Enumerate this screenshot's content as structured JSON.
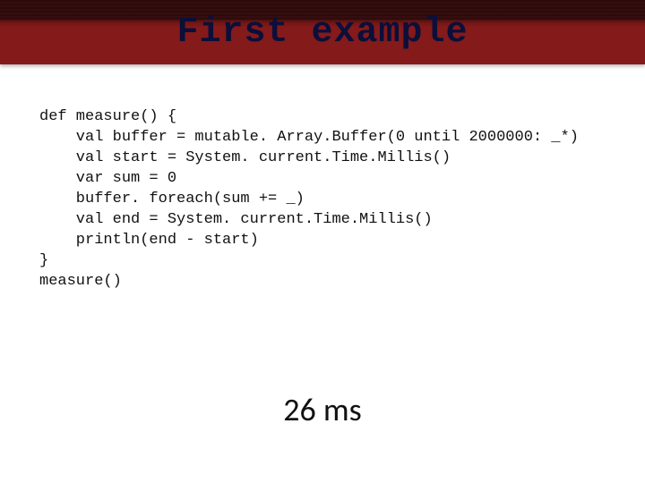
{
  "slide": {
    "title": "First example",
    "code": "def measure() {\n    val buffer = mutable. Array.Buffer(0 until 2000000: _*)\n    val start = System. current.Time.Millis()\n    var sum = 0\n    buffer. foreach(sum += _)\n    val end = System. current.Time.Millis()\n    println(end - start)\n}\nmeasure()",
    "result": "26 ms"
  }
}
